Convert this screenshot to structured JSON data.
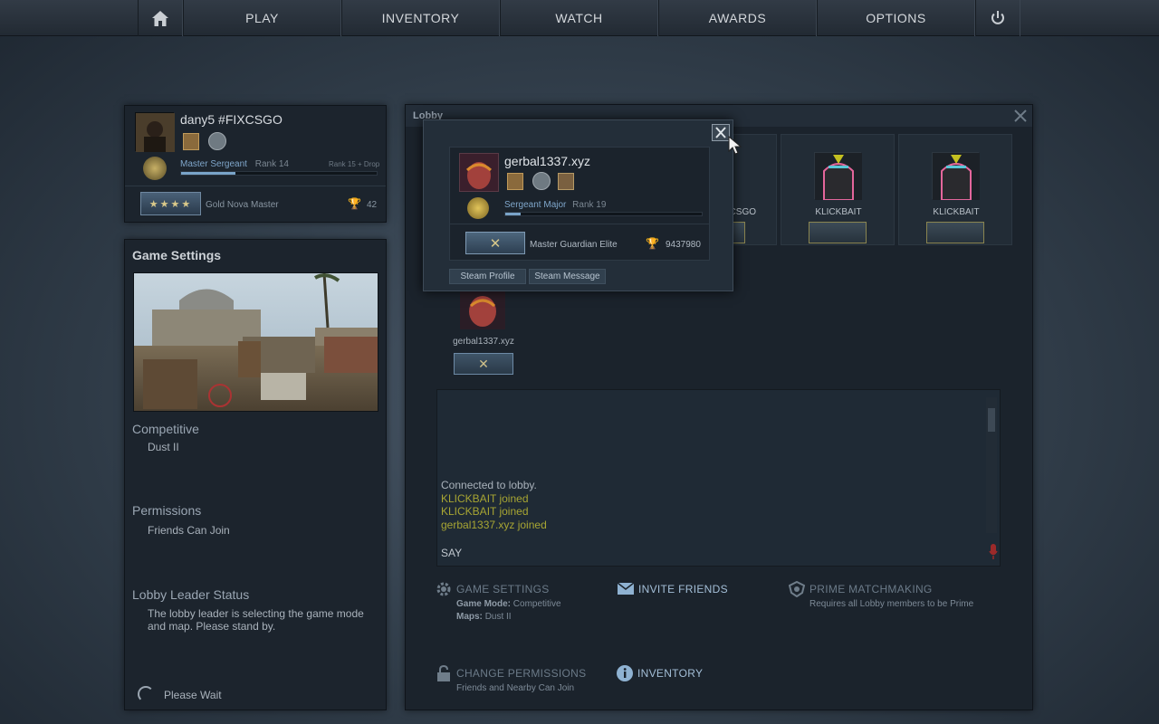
{
  "nav": {
    "items": [
      "PLAY",
      "INVENTORY",
      "WATCH",
      "AWARDS",
      "OPTIONS"
    ],
    "home_icon": "home-icon",
    "power_icon": "power-icon"
  },
  "profile": {
    "name": "dany5 #FIXCSGO",
    "rank_title": "Master Sergeant",
    "rank_level": "Rank 14",
    "next_rank": "Rank 15 + Drop",
    "xp_progress": 0.28,
    "skill_group": "Gold Nova Master",
    "trophy_count": "42"
  },
  "game_settings": {
    "title": "Game Settings",
    "mode": "Competitive",
    "map": "Dust II",
    "permissions_label": "Permissions",
    "permissions_value": "Friends Can Join",
    "leader_label": "Lobby Leader Status",
    "leader_text": "The lobby leader is selecting the game mode and map. Please stand by.",
    "wait_text": "Please Wait"
  },
  "lobby": {
    "title": "Lobby",
    "slot_partial_name": "CSGO",
    "members": [
      "KLICKBAIT",
      "KLICKBAIT"
    ],
    "self_name": "gerbal1337.xyz",
    "chat": {
      "lines": [
        {
          "text": "Connected to lobby.",
          "color": "#a9b2bb"
        },
        {
          "text": "KLICKBAIT joined",
          "color": "#a7a533"
        },
        {
          "text": "KLICKBAIT joined",
          "color": "#a7a533"
        },
        {
          "text": "gerbal1337.xyz joined",
          "color": "#a7a533"
        }
      ],
      "say_label": "SAY"
    },
    "actions": {
      "game_settings": {
        "title": "GAME SETTINGS",
        "mode_label": "Game Mode:",
        "mode_value": "Competitive",
        "maps_label": "Maps:",
        "maps_value": "Dust II"
      },
      "invite": {
        "title": "INVITE FRIENDS"
      },
      "prime": {
        "title": "PRIME MATCHMAKING",
        "desc": "Requires all Lobby members to be Prime"
      },
      "permissions": {
        "title": "CHANGE PERMISSIONS",
        "desc": "Friends and Nearby Can Join"
      },
      "inventory": {
        "title": "INVENTORY"
      }
    }
  },
  "popup": {
    "name": "gerbal1337.xyz",
    "rank_title": "Sergeant Major",
    "rank_level": "Rank 19",
    "xp_progress": 0.08,
    "skill_group": "Master Guardian Elite",
    "trophy_count": "9437980",
    "steam_profile": "Steam Profile",
    "steam_message": "Steam Message"
  },
  "colors": {
    "accent": "#a4bfd8",
    "join_text": "#a7a533"
  }
}
